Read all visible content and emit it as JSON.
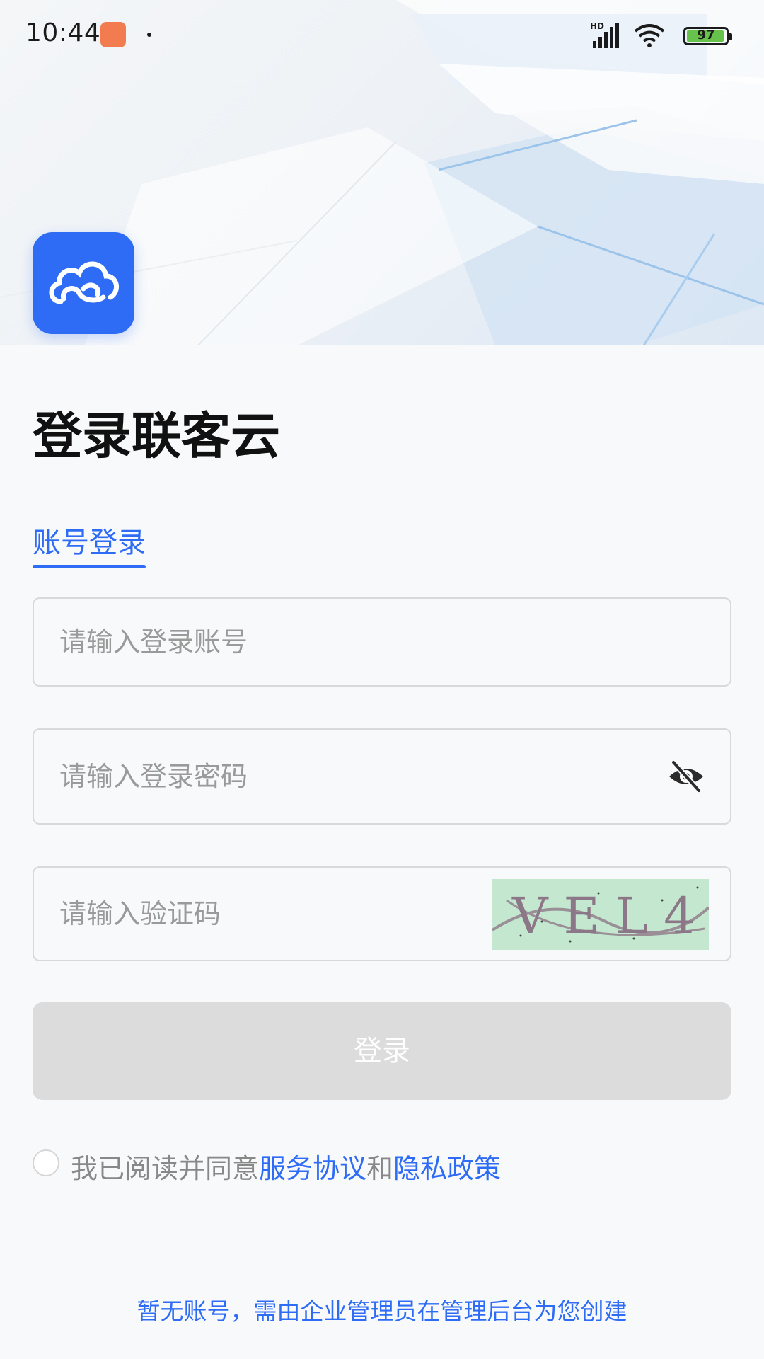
{
  "status_bar": {
    "time": "10:44",
    "battery_level": 97,
    "battery_label": "97",
    "network_label": "HD"
  },
  "app": {
    "logo_icon": "cloud-icon",
    "brand_color": "#2f6cf6"
  },
  "login": {
    "title": "登录联客云",
    "tab_label": "账号登录",
    "account_placeholder": "请输入登录账号",
    "password_placeholder": "请输入登录密码",
    "captcha_placeholder": "请输入验证码",
    "captcha_text": "VEL4",
    "submit_label": "登录",
    "submit_bg": "#dcdcdc"
  },
  "agreement": {
    "prefix": "我已阅读并同意",
    "service_link": "服务协议",
    "conjunction": "和",
    "privacy_link": "隐私政策"
  },
  "footer": {
    "note": "暂无账号，需由企业管理员在管理后台为您创建"
  }
}
